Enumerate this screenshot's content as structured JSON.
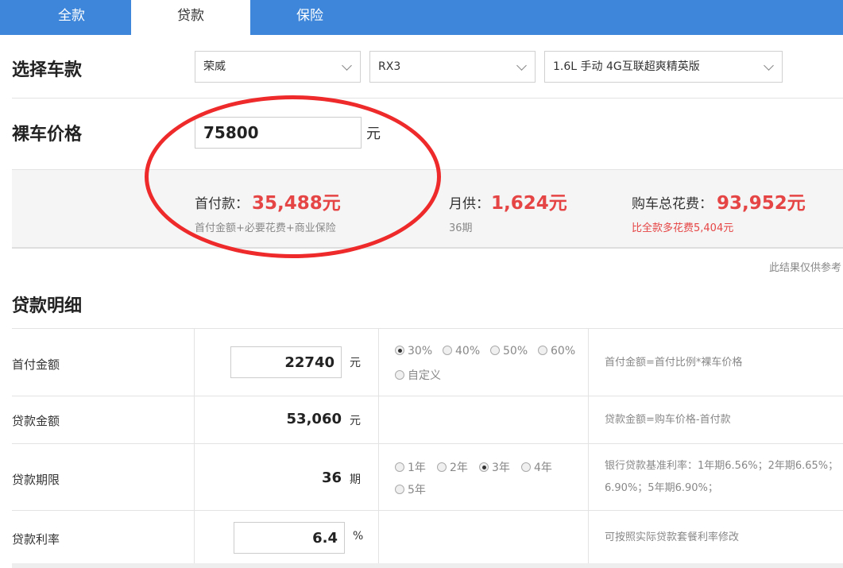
{
  "tabs": [
    {
      "label": "全款",
      "active": false
    },
    {
      "label": "贷款",
      "active": true
    },
    {
      "label": "保险",
      "active": false
    }
  ],
  "select_model": {
    "title": "选择车款",
    "brand": "荣威",
    "series": "RX3",
    "trim": "1.6L 手动 4G互联超爽精英版"
  },
  "price": {
    "title": "裸车价格",
    "value": "75800",
    "unit": "元"
  },
  "summary": {
    "down_label": "首付款：",
    "down_value": "35,488元",
    "down_sub": "首付金额+必要花费+商业保险",
    "monthly_label": "月供：",
    "monthly_value": "1,624元",
    "monthly_sub": "36期",
    "total_label": "购车总花费：",
    "total_value": "93,952元",
    "total_sub": "比全款多花费5,404元"
  },
  "note": "此结果仅供参考",
  "details": {
    "title": "贷款明细",
    "down_payment": {
      "label": "首付金额",
      "value": "22740",
      "unit": "元",
      "options": [
        "30%",
        "40%",
        "50%",
        "60%",
        "自定义"
      ],
      "selected": "30%",
      "desc": "首付金额=首付比例*裸车价格"
    },
    "loan_amount": {
      "label": "贷款金额",
      "value": "53,060",
      "unit": "元",
      "desc": "贷款金额=购车价格-首付款"
    },
    "loan_term": {
      "label": "贷款期限",
      "value": "36",
      "unit": "期",
      "options": [
        "1年",
        "2年",
        "3年",
        "4年",
        "5年"
      ],
      "selected": "3年",
      "desc_line1": "银行贷款基准利率：1年期6.56%；2年期6.65%；",
      "desc_line2": "6.90%；5年期6.90%；"
    },
    "rate": {
      "label": "贷款利率",
      "value": "6.4",
      "unit": "%",
      "desc": "可按照实际贷款套餐利率修改"
    }
  },
  "colors": {
    "tab_blue": "#3d86d9",
    "accent_red": "#e64545",
    "annotation_red": "#ee2a2a"
  }
}
